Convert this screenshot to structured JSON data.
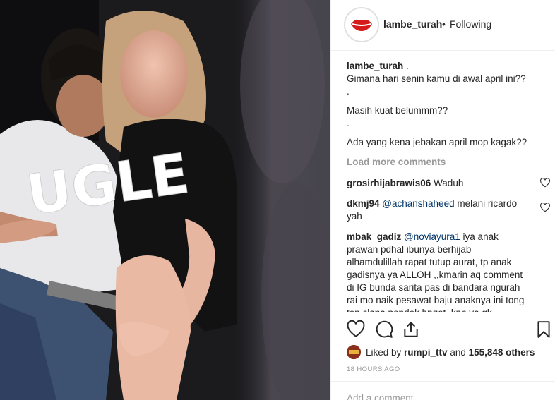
{
  "post": {
    "username": "lambe_turah",
    "separator": "•",
    "follow_status": "Following",
    "caption": {
      "user": "lambe_turah",
      "suffix": " .",
      "lines": [
        "Gimana hari senin kamu di awal april ini??",
        ".",
        "Masih kuat belummm??",
        ".",
        "Ada yang kena jebakan april mop kagak??"
      ]
    },
    "load_more": "Load more comments",
    "comments": [
      {
        "user": "grosirhijabrawis06",
        "mention": "",
        "text": " Waduh"
      },
      {
        "user": "dkmj94",
        "mention": "@achanshaheed",
        "text": " melani ricardo yah"
      },
      {
        "user": "mbak_gadiz",
        "mention": "@noviayura1",
        "text": " iya anak prawan pdhal ibunya berhijab alhamdulillah rapat tutup aurat, tp anak gadisnya ya ALLOH ,,kmarin aq comment di IG bunda sarita pas di bandara ngurah rai mo naik pesawat baju anaknya ini tong tep clana pendek bnget,,knp ya gk nasehati putrinya berbusana yg sopan lh"
      }
    ],
    "likes": {
      "prefix": "Liked by ",
      "user": "rumpi_ttv",
      "middle": " and ",
      "count": "155,848 others"
    },
    "timestamp": "18 HOURS AGO",
    "add_comment_placeholder": "Add a comment..."
  },
  "photo": {
    "overlay_text": "UGLE"
  },
  "icons": {
    "avatar": "red-lips-logo-icon",
    "like": "heart-icon",
    "comment": "speech-bubble-icon",
    "share": "share-icon",
    "save": "bookmark-icon",
    "comment_like": "heart-outline-icon"
  },
  "colors": {
    "text": "#262626",
    "muted": "#999999",
    "mention": "#003569",
    "border": "#efefef"
  }
}
